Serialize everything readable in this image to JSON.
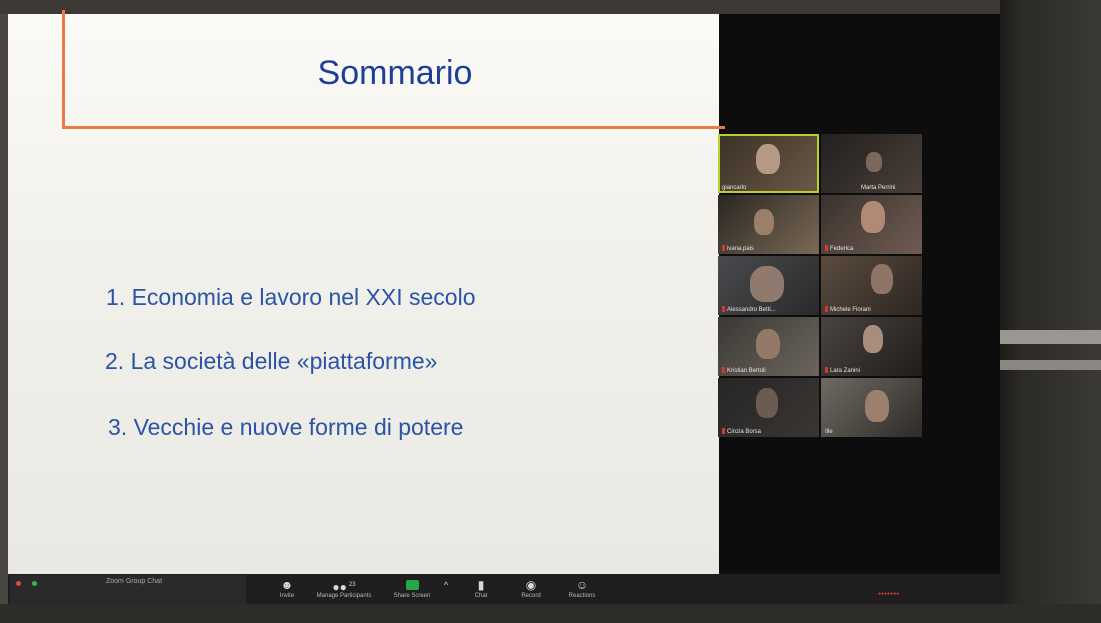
{
  "slide": {
    "title": "Sommario",
    "items": [
      "1. Economia e lavoro nel XXI secolo",
      "2. La società delle «piattaforme»",
      "3. Vecchie e nuove forme di potere"
    ]
  },
  "participants": [
    {
      "name": "giancarlo",
      "active": true
    },
    {
      "name": "Marta Perrini"
    },
    {
      "name": "ivana.pais"
    },
    {
      "name": "Federica"
    },
    {
      "name": "Alessandro Betti..."
    },
    {
      "name": "Michele Fiorani"
    },
    {
      "name": "Kristian Bertoli"
    },
    {
      "name": "Lara Zanini"
    },
    {
      "name": "Cinzia Borsa"
    },
    {
      "name": "Ille"
    }
  ],
  "chat_window": {
    "title": "Zoom Group Chat"
  },
  "toolbar": {
    "invite": "Invite",
    "participants_count": "23",
    "manage_participants": "Manage Participants",
    "share_screen": "Share Screen",
    "chat": "Chat",
    "record": "Record",
    "reactions": "Reactions"
  },
  "colors": {
    "title_text": "#1f3f96",
    "item_text": "#2b53a6",
    "accent_line": "#e77a45",
    "share_green": "#26a644",
    "active_speaker": "#b7d230"
  }
}
